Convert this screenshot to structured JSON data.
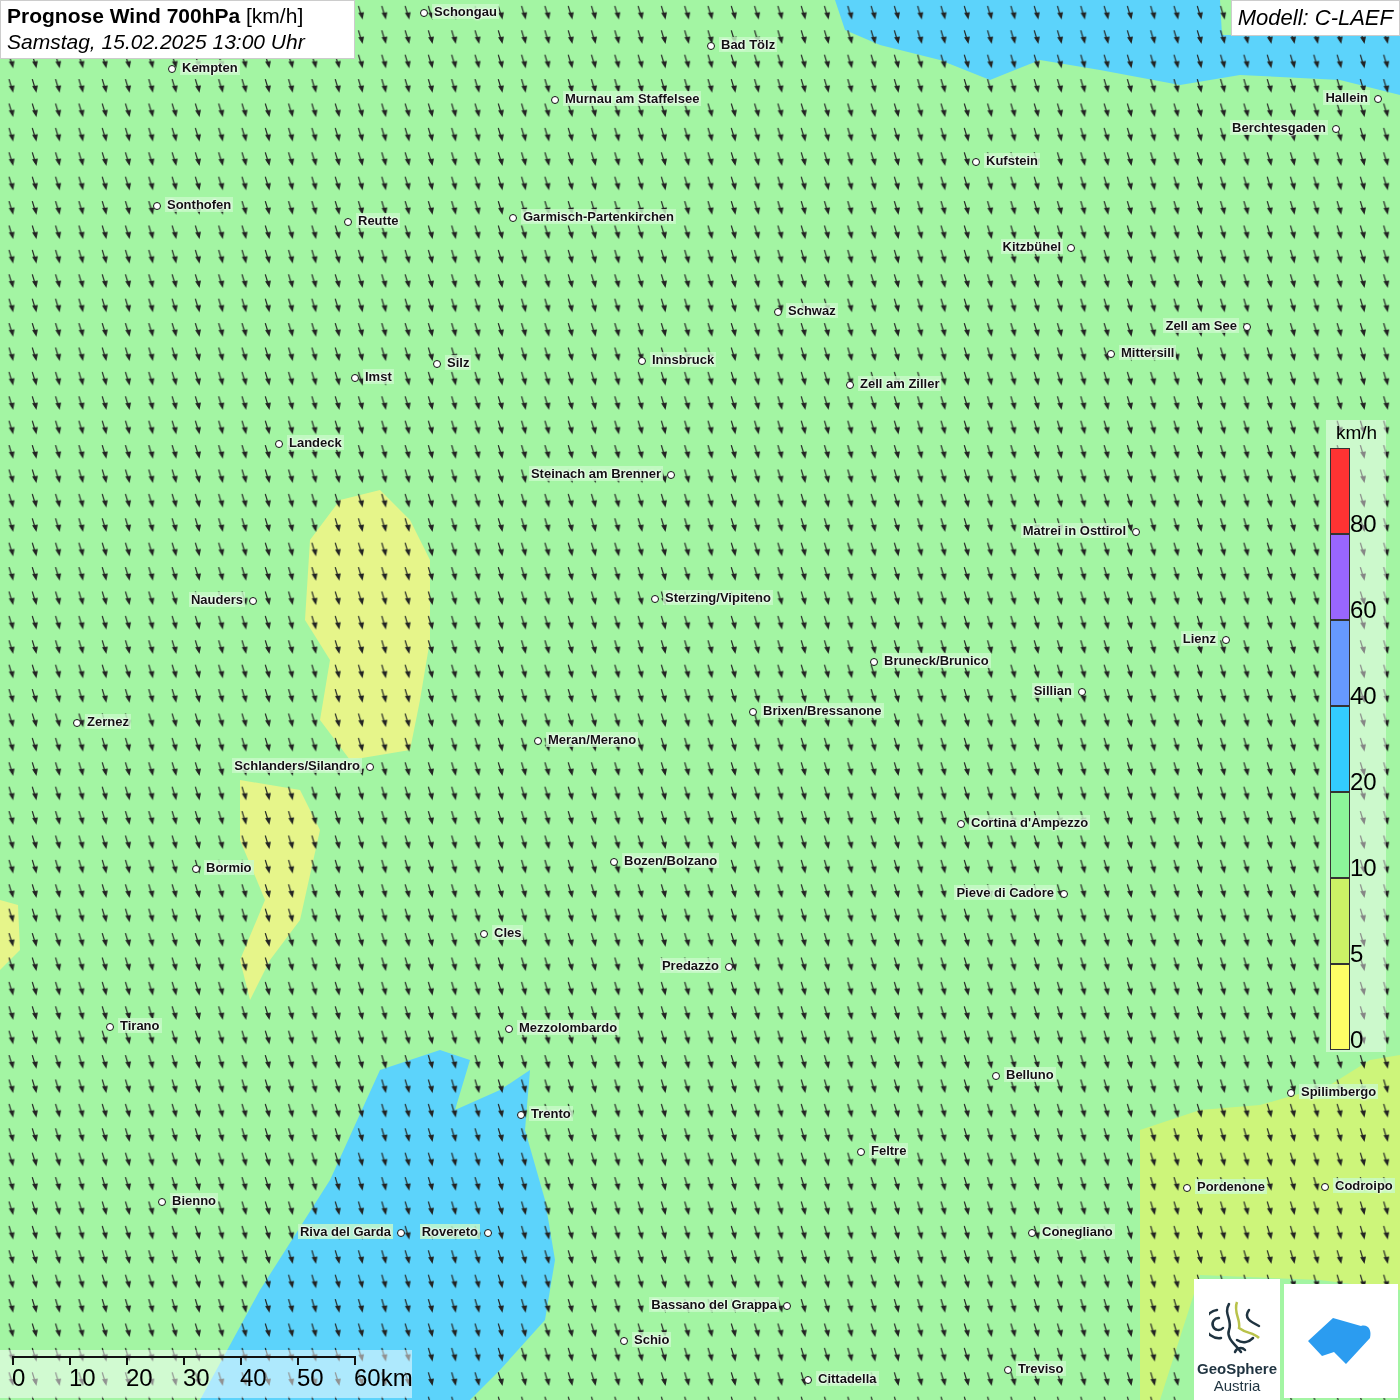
{
  "header": {
    "title": "**Prognose Wind 700hPa** [km/h]",
    "subtitle": "Samstag, 15.02.2025 13:00 Uhr"
  },
  "model": "Modell: C-LAEF",
  "cities": [
    "Schongau",
    "Bad Tölz",
    "Kempten",
    "Murnau am Staffelsee",
    "Hallein",
    "Berchtesgaden",
    "Kufstein",
    "Sonthofen",
    "Reutte",
    "Garmisch-Partenkirchen",
    "Kitzbühel",
    "Schwaz",
    "Zell am See",
    "Mittersill",
    "Innsbruck",
    "Silz",
    "Imst",
    "Zell am Ziller",
    "Landeck",
    "Steinach am Brenner",
    "Matrei in Osttirol",
    "Nauders",
    "Sterzing/Vipiteno",
    "Lienz",
    "Bruneck/Brunico",
    "Sillian",
    "Brixen/Bressanone",
    "Zernez",
    "Meran/Merano",
    "Schlanders/Silandro",
    "Cortina d'Ampezzo",
    "Bozen/Bolzano",
    "Bormio",
    "Pieve di Cadore",
    "Cles",
    "Predazzo",
    "Tirano",
    "Mezzolombardo",
    "Belluno",
    "Spilimbergo",
    "Trento",
    "Feltre",
    "Pordenone",
    "Codroipo",
    "Bienno",
    "Riva del Garda",
    "Rovereto",
    "Conegliano",
    "Bassano del Grappa",
    "Schio",
    "Treviso",
    "Cittadella"
  ],
  "legend": {
    "unit": "km/h",
    "bands": [
      {
        "label": "80",
        "color": "#ff3333"
      },
      {
        "label": "60",
        "color": "#9966ff"
      },
      {
        "label": "40",
        "color": "#6699ff"
      },
      {
        "label": "20",
        "color": "#33ccff"
      },
      {
        "label": "10",
        "color": "#8cf59a"
      },
      {
        "label": "5",
        "color": "#ccf266"
      },
      {
        "label": "0",
        "color": "#ffff66"
      }
    ]
  },
  "scale": [
    "0",
    "10",
    "20",
    "30",
    "40",
    "50",
    "60km"
  ],
  "logo": {
    "name": "GeoSphere",
    "subtitle": "Austria"
  }
}
